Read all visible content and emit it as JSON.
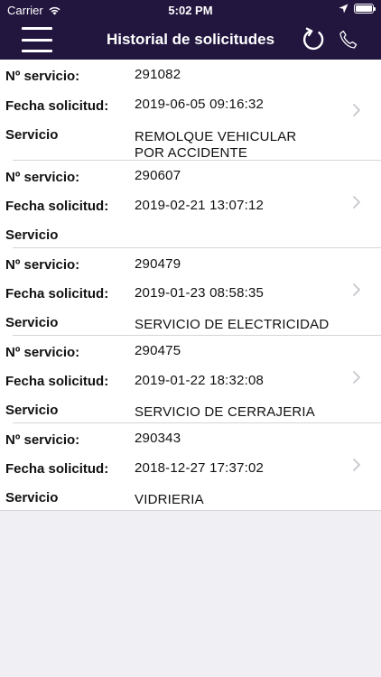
{
  "status_bar": {
    "carrier": "Carrier",
    "time": "5:02 PM",
    "battery_level": 1.0
  },
  "nav": {
    "title": "Historial de solicitudes",
    "menu_icon": "hamburger-menu-icon",
    "refresh_icon": "refresh-icon",
    "phone_icon": "phone-icon"
  },
  "labels": {
    "service_number": "Nº servicio:",
    "request_date": "Fecha solicitud:",
    "service": "Servicio"
  },
  "requests": [
    {
      "number": "291082",
      "date": "2019-06-05 09:16:32",
      "service": "REMOLQUE VEHICULAR\nPOR ACCIDENTE"
    },
    {
      "number": "290607",
      "date": "2019-02-21 13:07:12",
      "service": ""
    },
    {
      "number": "290479",
      "date": "2019-01-23 08:58:35",
      "service": "SERVICIO DE ELECTRICIDAD"
    },
    {
      "number": "290475",
      "date": "2019-01-22 18:32:08",
      "service": "SERVICIO DE CERRAJERIA"
    },
    {
      "number": "290343",
      "date": "2018-12-27 17:37:02",
      "service": "VIDRIERIA"
    }
  ],
  "colors": {
    "nav_background": "#22163f",
    "page_background": "#efeff4",
    "chevron": "#c7c7cc"
  }
}
